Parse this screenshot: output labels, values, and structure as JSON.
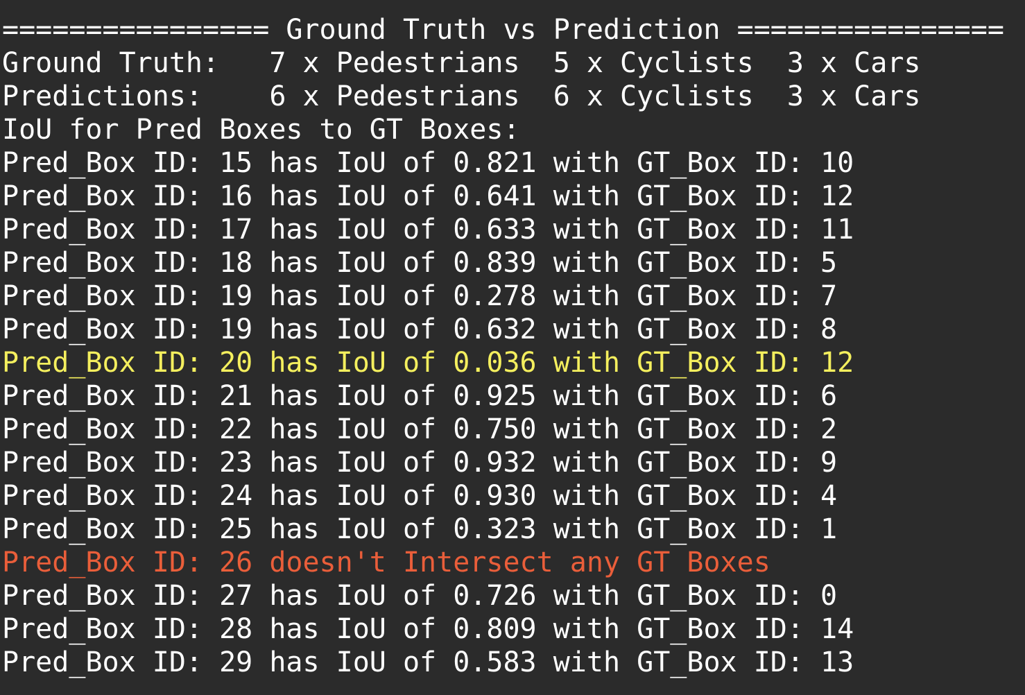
{
  "terminal": {
    "lines": [
      {
        "text": "================ Ground Truth vs Prediction ================",
        "kind": "normal"
      },
      {
        "text": "Ground Truth:   7 x Pedestrians  5 x Cyclists  3 x Cars",
        "kind": "normal"
      },
      {
        "text": "Predictions:    6 x Pedestrians  6 x Cyclists  3 x Cars",
        "kind": "normal"
      },
      {
        "text": "IoU for Pred Boxes to GT Boxes:",
        "kind": "normal"
      },
      {
        "text": "Pred_Box ID: 15 has IoU of 0.821 with GT_Box ID: 10",
        "kind": "normal"
      },
      {
        "text": "Pred_Box ID: 16 has IoU of 0.641 with GT_Box ID: 12",
        "kind": "normal"
      },
      {
        "text": "Pred_Box ID: 17 has IoU of 0.633 with GT_Box ID: 11",
        "kind": "normal"
      },
      {
        "text": "Pred_Box ID: 18 has IoU of 0.839 with GT_Box ID: 5",
        "kind": "normal"
      },
      {
        "text": "Pred_Box ID: 19 has IoU of 0.278 with GT_Box ID: 7",
        "kind": "normal"
      },
      {
        "text": "Pred_Box ID: 19 has IoU of 0.632 with GT_Box ID: 8",
        "kind": "normal"
      },
      {
        "text": "Pred_Box ID: 20 has IoU of 0.036 with GT_Box ID: 12",
        "kind": "warn"
      },
      {
        "text": "Pred_Box ID: 21 has IoU of 0.925 with GT_Box ID: 6",
        "kind": "normal"
      },
      {
        "text": "Pred_Box ID: 22 has IoU of 0.750 with GT_Box ID: 2",
        "kind": "normal"
      },
      {
        "text": "Pred_Box ID: 23 has IoU of 0.932 with GT_Box ID: 9",
        "kind": "normal"
      },
      {
        "text": "Pred_Box ID: 24 has IoU of 0.930 with GT_Box ID: 4",
        "kind": "normal"
      },
      {
        "text": "Pred_Box ID: 25 has IoU of 0.323 with GT_Box ID: 1",
        "kind": "normal"
      },
      {
        "text": "Pred_Box ID: 26 doesn't Intersect any GT Boxes",
        "kind": "error"
      },
      {
        "text": "Pred_Box ID: 27 has IoU of 0.726 with GT_Box ID: 0",
        "kind": "normal"
      },
      {
        "text": "Pred_Box ID: 28 has IoU of 0.809 with GT_Box ID: 14",
        "kind": "normal"
      },
      {
        "text": "Pred_Box ID: 29 has IoU of 0.583 with GT_Box ID: 13",
        "kind": "normal"
      }
    ]
  },
  "colors": {
    "background": "#2b2b2b",
    "text": "#ffffff",
    "warn": "#f4ef5e",
    "error": "#ea5e3a"
  }
}
